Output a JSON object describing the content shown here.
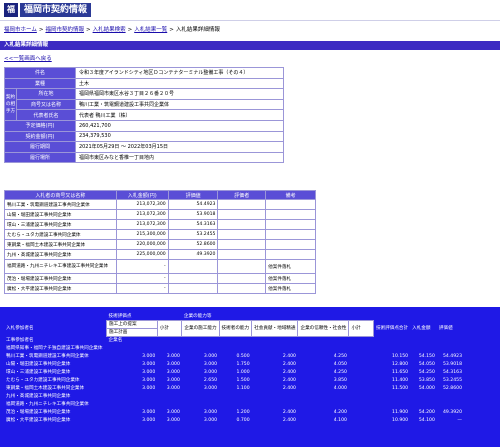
{
  "header": {
    "logo_badge": "福",
    "logo_text": "福岡市契約情報"
  },
  "breadcrumb": {
    "items": [
      "福岡市ホーム",
      "福岡市契約情報",
      "入札結果検索",
      "入札結果一覧"
    ],
    "separator": ">",
    "current": "入札結果詳細情報"
  },
  "section_title": "入札結果詳細情報",
  "back_link": "<<一覧画面へ戻る",
  "info": {
    "rows": [
      {
        "label": "件名",
        "value": "令和３年度アイランドシティ地区Ｄコンテナターミナル整備工事（その４）"
      },
      {
        "label": "業種",
        "value": "土木"
      },
      {
        "label": "所在地",
        "value": "福岡県福岡市東区水谷３丁目２６番２０号"
      },
      {
        "label": "商号又は名称",
        "value": "鴨川工業・筑電鋼道建設工事共同企業体"
      },
      {
        "label": "代表者氏名",
        "value": "代表者 鴨川工業（株）"
      },
      {
        "label": "予定価格(円)",
        "value": "260,421,700"
      },
      {
        "label": "契約金額(円)",
        "value": "234,379,530"
      },
      {
        "label": "履行期間",
        "value": "2021年05月29日 ～ 2022年03月15日"
      },
      {
        "label": "履行場所",
        "value": "福岡市東区みなと香椎一丁目地内"
      }
    ],
    "vertical_label": "契約の相手方"
  },
  "bids": {
    "headers": [
      "入札者の商号又は名称",
      "入札金額(円)",
      "評価値",
      "評価者",
      "備考"
    ],
    "rows": [
      {
        "name": "鴨川工業・筑電鋼道建設工事共同企業体",
        "amount": "213,072,300",
        "score": "54.4923",
        "note": ""
      },
      {
        "name": "山陽・堀田建設工事共同企業体",
        "amount": "213,072,300",
        "score": "53.9018",
        "note": ""
      },
      {
        "name": "環山・三浦建設工事共同企業体",
        "amount": "213,072,300",
        "score": "54.3163",
        "note": ""
      },
      {
        "name": "たむら・ユタカ建設工事共同企業体",
        "amount": "215,300,000",
        "score": "53.2455",
        "note": ""
      },
      {
        "name": "東鋼業・福岡土木建設工事共同企業体",
        "amount": "220,000,000",
        "score": "52.8600",
        "note": ""
      },
      {
        "name": "九州・髙城建設工事共同企業体",
        "amount": "225,000,000",
        "score": "49.3920",
        "note": ""
      },
      {
        "name": "福岡道路・九州ニチレキ工事建設工事共同企業体",
        "amount": "-",
        "score": "",
        "note": "他案件落札",
        "tall": true
      },
      {
        "name": "茂治・堀場建設工事共同企業体",
        "amount": "-",
        "score": "",
        "note": "他案件落札"
      },
      {
        "name": "廣松・大平建設工事共同企業体",
        "amount": "-",
        "score": "",
        "note": "他案件落札"
      }
    ]
  },
  "eval": {
    "top_header": [
      "技術評価点",
      "企業の能力等"
    ],
    "col_header_row1": [
      "入札参加者名",
      "施工上の提案",
      "小計",
      "企業の施工能力",
      "技術者の能力",
      "社会貢献・地域精通",
      "企業の信頼性・社会性",
      "小計",
      "技術評価点合計",
      "入札金額",
      "評価値"
    ],
    "col_header_row2": [
      "",
      "施工計画",
      "",
      "",
      "",
      "",
      "",
      "",
      "",
      "",
      ""
    ],
    "rows": [
      [
        "工事参加者名",
        "企業名",
        "",
        "",
        "",
        "",
        "",
        "",
        "",
        "",
        ""
      ],
      [
        "福岡県知事・福岡ナチ独自建設工事共同企業体",
        "",
        "",
        "",
        "",
        "",
        "",
        "",
        "",
        "",
        ""
      ],
      [
        "鴨川工業・筑電鋼道建設工事共同企業体",
        "3.000",
        "3.000",
        "3.000",
        "0.500",
        "2.400",
        "4.250",
        "",
        "10.150",
        "54.150",
        "54.4923"
      ],
      [
        "山陽・堀田建設工事共同企業体",
        "3.000",
        "3.000",
        "3.000",
        "1.750",
        "2.400",
        "4.050",
        "",
        "12.800",
        "54.050",
        "53.9018"
      ],
      [
        "環山・三浦建設工事共同企業体",
        "3.000",
        "3.000",
        "3.000",
        "1.000",
        "2.400",
        "4.250",
        "",
        "11.650",
        "54.250",
        "54.3163"
      ],
      [
        "たむら・ユタカ建設工事共同企業体",
        "3.000",
        "3.000",
        "2.650",
        "1.500",
        "2.400",
        "3.850",
        "",
        "11.400",
        "53.850",
        "53.2455"
      ],
      [
        "東鋼業・福岡土木建設工事共同企業体",
        "3.000",
        "3.000",
        "3.000",
        "1.100",
        "2.400",
        "4.000",
        "",
        "11.500",
        "54.000",
        "52.8600"
      ],
      [
        "九州・髙城建設工事共同企業体",
        "",
        "",
        "",
        "",
        "",
        "",
        "",
        "",
        "",
        ""
      ],
      [
        "福岡道路・九州ニチレキ工事共同企業体",
        "",
        "",
        "",
        "",
        "",
        "",
        "",
        "",
        "",
        ""
      ],
      [
        "茂治・堀場建設工事共同企業体",
        "3.000",
        "3.000",
        "3.000",
        "1.200",
        "2.400",
        "4.200",
        "",
        "11.900",
        "54.200",
        "49.3920"
      ],
      [
        "廣松・大平建設工事共同企業体",
        "3.000",
        "3.000",
        "3.000",
        "0.700",
        "2.400",
        "4.100",
        "",
        "10.900",
        "54.100",
        "—"
      ]
    ]
  },
  "colors": {
    "accent": "#5a4ed6",
    "section_bar": "#3c2bc2",
    "eval_bg": "#1f19e6",
    "link": "#1a0dab"
  }
}
